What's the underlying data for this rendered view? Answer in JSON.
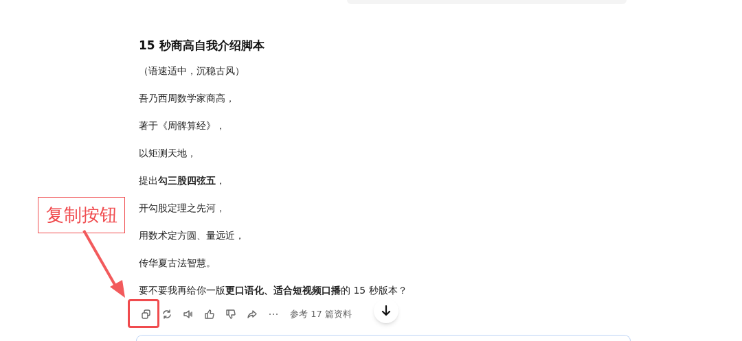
{
  "response": {
    "title": "15 秒商高自我介绍脚本",
    "paragraphs": [
      "（语速适中，沉稳古风）",
      "吾乃西周数学家商高，",
      "著于《周髀算经》，",
      "以矩测天地，",
      "提出**勾三股四弦五**，",
      "开勾股定理之先河，",
      "用数术定方圆、量远近，",
      "传华夏古法智慧。",
      "要不要我再给你一版**更口语化、适合短视频口播**的 15 秒版本？"
    ]
  },
  "actions": [
    {
      "kind": "copy"
    },
    {
      "kind": "regenerate"
    },
    {
      "kind": "read-aloud"
    },
    {
      "kind": "like"
    },
    {
      "kind": "dislike"
    },
    {
      "kind": "share"
    },
    {
      "kind": "more"
    }
  ],
  "references": "参考 17 篇资料",
  "annotation": {
    "label": "复制按钮"
  }
}
